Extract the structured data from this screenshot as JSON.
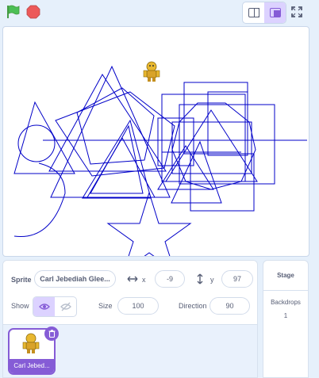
{
  "controls": {
    "green_flag_icon": "green-flag",
    "stop_icon": "stop-sign"
  },
  "stage": {
    "line_color": "#0000c8"
  },
  "sprite_info": {
    "sprite_label": "Sprite",
    "sprite_name": "Carl Jebediah Glee...",
    "x_label": "x",
    "x_value": "-9",
    "y_label": "y",
    "y_value": "97",
    "show_label": "Show",
    "size_label": "Size",
    "size_value": "100",
    "direction_label": "Direction",
    "direction_value": "90"
  },
  "sprite_list": {
    "items": [
      {
        "name": "Carl Jebed...",
        "selected": true
      }
    ]
  },
  "stage_pane": {
    "title": "Stage",
    "backdrops_label": "Backdrops",
    "backdrops_count": "1"
  },
  "colors": {
    "accent": "#855cd6",
    "accent_light": "#dcd2ff",
    "background": "#e6f0fb"
  }
}
